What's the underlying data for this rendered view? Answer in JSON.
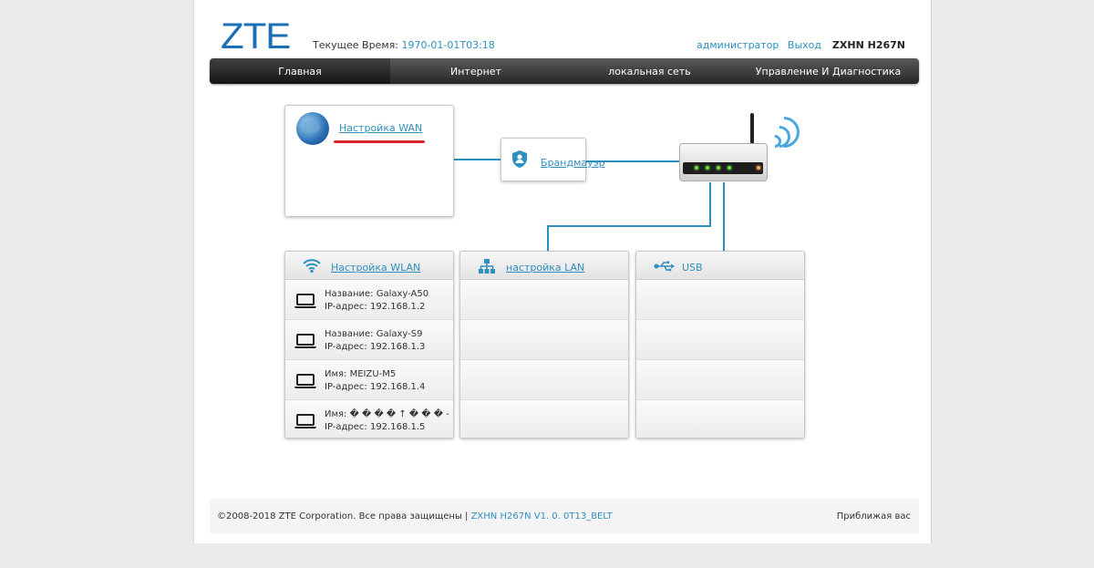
{
  "header": {
    "logo": "ZTE",
    "time_label": "Текущее Время:",
    "time_value": "1970-01-01T03:18",
    "user": "администратор",
    "logout": "Выход",
    "model": "ZXHN H267N"
  },
  "nav": {
    "tabs": [
      {
        "label": "Главная",
        "active": true
      },
      {
        "label": "Интернет",
        "active": false
      },
      {
        "label": "локальная сеть",
        "active": false
      },
      {
        "label": "Управление И Диагностика",
        "active": false
      }
    ]
  },
  "topology": {
    "wan_label": "Настройка WAN",
    "firewall_label": "Брандмауэр"
  },
  "wlan": {
    "title": "Настройка WLAN",
    "devices": [
      {
        "name": "Название: Galaxy-A50",
        "ip": "IP-адрес: 192.168.1.2"
      },
      {
        "name": "Название: Galaxy-S9",
        "ip": "IP-адрес: 192.168.1.3"
      },
      {
        "name": "Имя: MEIZU-M5",
        "ip": "IP-адрес: 192.168.1.4"
      },
      {
        "name": "Имя: � � � � ↑ � � � - � ...",
        "ip": "IP-адрес: 192.168.1.5"
      }
    ]
  },
  "lan": {
    "title": "настройка LAN"
  },
  "usb": {
    "title": "USB"
  },
  "footer": {
    "copyright": "©2008-2018 ZTE Corporation. Все права защищены |",
    "version": "ZXHN H267N V1. 0. 0T13_BELT",
    "slogan": "Приближая вас"
  },
  "colors": {
    "accent": "#2e90c0",
    "logo": "#1a6fb7",
    "wire": "#2a8fbf",
    "underline": "#d9242d"
  }
}
